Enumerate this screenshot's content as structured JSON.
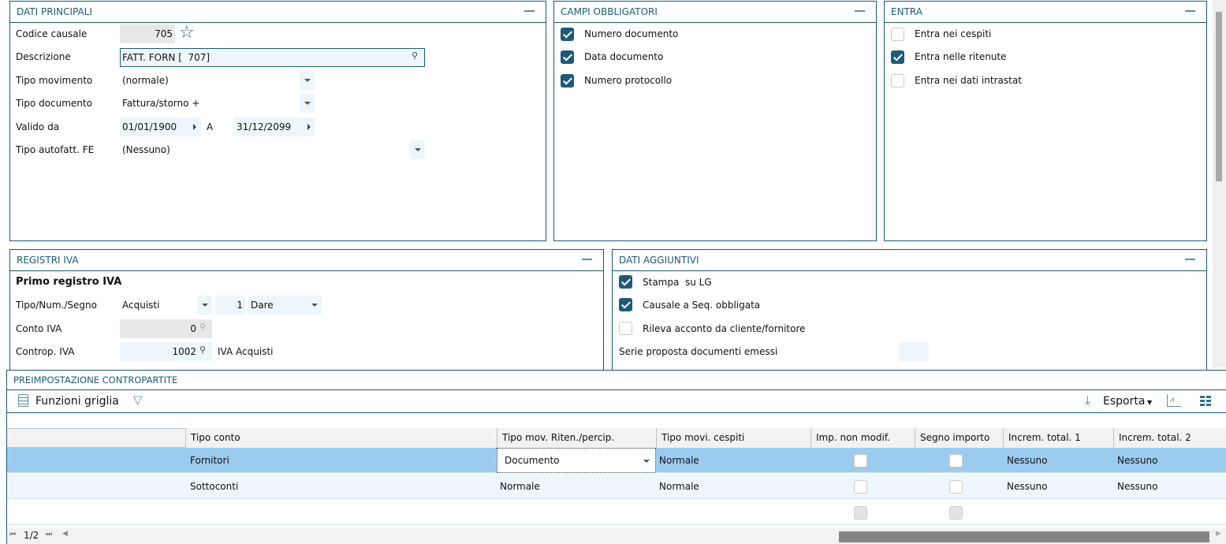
{
  "dati_principali": {
    "title": "DATI PRINCIPALI",
    "codice_label": "Codice causale",
    "codice_value": "705",
    "descrizione_label": "Descrizione",
    "descrizione_value": "FATT. FORN [  707]",
    "tipo_movimento_label": "Tipo movimento",
    "tipo_movimento_value": "(normale)",
    "tipo_documento_label": "Tipo documento",
    "tipo_documento_value": "Fattura/storno +",
    "valido_label": "Valido da",
    "valido_da": "01/01/1900",
    "a_label": "A",
    "valido_a": "31/12/2099",
    "autofatt_label": "Tipo autofatt. FE",
    "autofatt_value": "(Nessuno)"
  },
  "campi_obbligatori": {
    "title": "CAMPI OBBLIGATORI",
    "items": [
      {
        "label": "Numero documento",
        "checked": true
      },
      {
        "label": "Data documento",
        "checked": true
      },
      {
        "label": "Numero protocollo",
        "checked": true
      }
    ]
  },
  "entra": {
    "title": "ENTRA",
    "items": [
      {
        "label": "Entra nei cespiti",
        "checked": false
      },
      {
        "label": "Entra nelle ritenute",
        "checked": true
      },
      {
        "label": "Entra nei dati intrastat",
        "checked": false
      }
    ]
  },
  "registri_iva": {
    "title": "REGISTRI IVA",
    "subtitle": "Primo registro IVA",
    "tipo_label": "Tipo/Num./Segno",
    "tipo_value": "Acquisti",
    "num_value": "1",
    "segno_value": "Dare",
    "conto_label": "Conto IVA",
    "conto_value": "0",
    "controp_label": "Controp. IVA",
    "controp_value": "1002",
    "controp_desc": "IVA Acquisti"
  },
  "dati_aggiuntivi": {
    "title": "DATI AGGIUNTIVI",
    "items": [
      {
        "label": "Stampa  su LG",
        "checked": true
      },
      {
        "label": "Causale a Seq. obbligata",
        "checked": true
      },
      {
        "label": "Rileva acconto da cliente/fornitore",
        "checked": false
      }
    ],
    "serie_label": "Serie proposta documenti emessi",
    "serie_value": ""
  },
  "grid": {
    "title": "PREIMPOSTAZIONE CONTROPARTITE",
    "funzioni_label": "Funzioni griglia",
    "esporta_label": "Esporta",
    "columns": [
      "",
      "Tipo conto",
      "Tipo mov. Riten./percip.",
      "Tipo movi. cespiti",
      "Imp. non modif.",
      "Segno importo",
      "Increm. total. 1",
      "Increm. total. 2"
    ],
    "rows": [
      {
        "tipo_conto": "Fornitori",
        "tipo_mov": "Documento",
        "cespiti": "Normale",
        "imp": false,
        "segno": false,
        "inc1": "Nessuno",
        "inc2": "Nessuno",
        "selected": true
      },
      {
        "tipo_conto": "Sottoconti",
        "tipo_mov": "Normale",
        "cespiti": "Normale",
        "imp": false,
        "segno": false,
        "inc1": "Nessuno",
        "inc2": "Nessuno",
        "selected": false
      }
    ],
    "page": "1/2"
  },
  "colors": {
    "accent": "#1d5a78",
    "selected_row": "#9ccbf0",
    "field_bg": "#eef6fc"
  }
}
